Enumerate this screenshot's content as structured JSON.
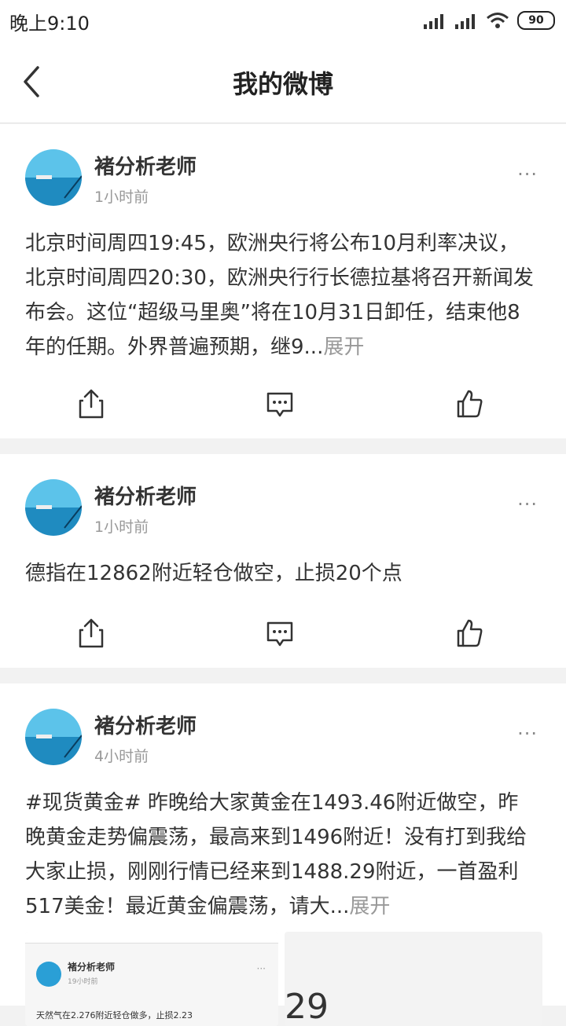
{
  "status": {
    "time": "晚上9:10",
    "battery": "90"
  },
  "header": {
    "title": "我的微博"
  },
  "posts": [
    {
      "author": "褚分析老师",
      "time": "1小时前",
      "text": "北京时间周四19:45，欧洲央行将公布10月利率决议，北京时间周四20:30，欧洲央行行长德拉基将召开新闻发布会。这位“超级马里奥”将在10月31日卸任，结束他8年的任期。外界普遍预期，继9...",
      "expand": "展开"
    },
    {
      "author": "褚分析老师",
      "time": "1小时前",
      "text": "德指在12862附近轻仓做空，止损20个点"
    },
    {
      "author": "褚分析老师",
      "time": "4小时前",
      "text": "#现货黄金# 昨晚给大家黄金在1493.46附近做空，昨晚黄金走势偏震荡，最高来到1496附近！没有打到我给大家止损，刚刚行情已经来到1488.29附近，一首盈利517美金！最近黄金偏震荡，请大...",
      "expand": "展开",
      "thumb": {
        "author": "褚分析老师",
        "time": "19小时前",
        "text": "天然气在2.276附近轻仓做多，止损2.23",
        "num": "29"
      }
    }
  ],
  "more_icon": "more-dots-icon"
}
